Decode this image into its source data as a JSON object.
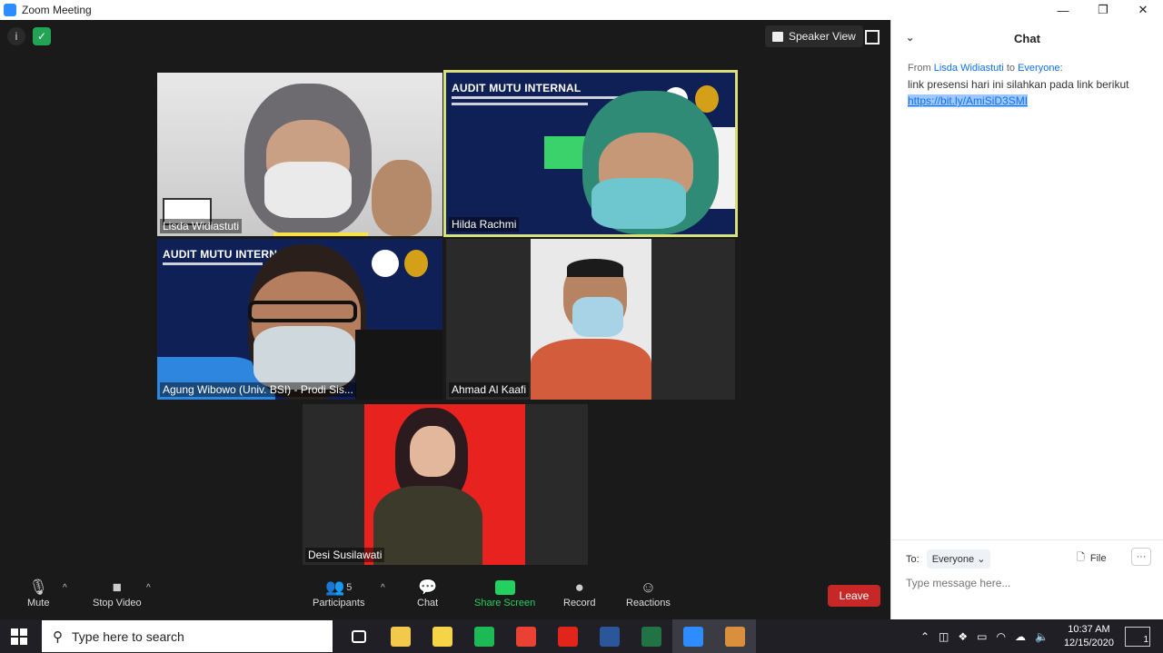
{
  "window": {
    "title": "Zoom Meeting",
    "controls": [
      "—",
      "❐",
      "✕"
    ]
  },
  "meeting": {
    "speaker_view_label": "Speaker View",
    "participants": [
      {
        "name": "Lisda Widiastuti"
      },
      {
        "name": "Hilda Rachmi"
      },
      {
        "name": "Agung Wibowo (Univ. BSI) - Prodi Sis..."
      },
      {
        "name": "Ahmad Al Kaafi"
      },
      {
        "name": "Desi Susilawati"
      }
    ],
    "slide_title": "AUDIT MUTU INTERNAL"
  },
  "toolbar": {
    "mute": "Mute",
    "stop_video": "Stop Video",
    "participants": "Participants",
    "participants_count": "5",
    "chat": "Chat",
    "share_screen": "Share Screen",
    "record": "Record",
    "reactions": "Reactions",
    "leave": "Leave"
  },
  "chat": {
    "title": "Chat",
    "messages": [
      {
        "from_label": "From",
        "from": "Lisda Widiastuti",
        "to_label": "to",
        "to": "Everyone:",
        "text": "link presensi hari ini silahkan pada link berikut",
        "link": "https://bit.ly/AmiSiD3SMI"
      }
    ],
    "to_prefix": "To:",
    "recipient": "Everyone",
    "file_label": "File",
    "more_label": "···",
    "input_placeholder": "Type message here..."
  },
  "taskbar": {
    "search_placeholder": "Type here to search",
    "time": "10:37 AM",
    "date": "12/15/2020",
    "notifications": "1",
    "apps": [
      {
        "icon": "task-view-icon",
        "color": "#1f1f25"
      },
      {
        "icon": "file-explorer-icon",
        "color": "#f2c94c"
      },
      {
        "icon": "sticky-notes-icon",
        "color": "#f5d547"
      },
      {
        "icon": "spotify-icon",
        "color": "#1db954"
      },
      {
        "icon": "chrome-icon",
        "color": "#e94235"
      },
      {
        "icon": "acrobat-icon",
        "color": "#e1251b"
      },
      {
        "icon": "word-icon",
        "color": "#2b579a"
      },
      {
        "icon": "excel-icon",
        "color": "#217346"
      },
      {
        "icon": "zoom-icon",
        "color": "#2d8cff"
      },
      {
        "icon": "paint-icon",
        "color": "#d98f3c"
      }
    ]
  }
}
